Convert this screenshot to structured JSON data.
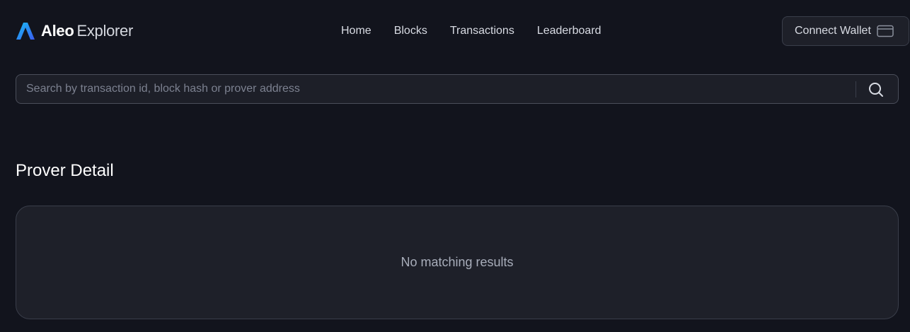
{
  "brand": {
    "name": "Aleo",
    "sub": "Explorer",
    "logo_icon": "aleo-logo-icon",
    "gradient_start": "#18c0f5",
    "gradient_end": "#3b5bf0"
  },
  "nav": {
    "items": [
      {
        "label": "Home"
      },
      {
        "label": "Blocks"
      },
      {
        "label": "Transactions"
      },
      {
        "label": "Leaderboard"
      }
    ]
  },
  "wallet": {
    "label": "Connect Wallet",
    "icon": "wallet-icon"
  },
  "search": {
    "placeholder": "Search by transaction id, block hash or prover address",
    "value": "",
    "icon": "search-icon"
  },
  "main": {
    "title": "Prover Detail",
    "empty_message": "No matching results"
  },
  "colors": {
    "background": "#12141d",
    "card": "#1e2029",
    "border": "#3a3e4a"
  }
}
